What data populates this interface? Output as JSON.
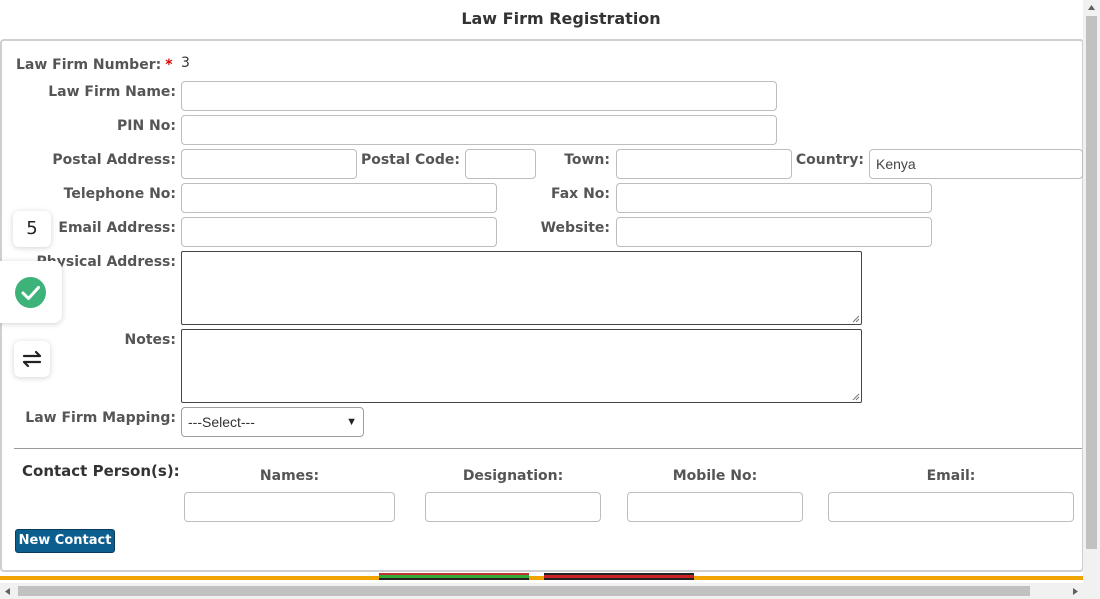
{
  "page": {
    "title": "Law Firm Registration"
  },
  "form": {
    "law_firm_number_label": "Law Firm Number:",
    "required_marker": "*",
    "law_firm_number_value": "3",
    "law_firm_name_label": "Law Firm Name:",
    "law_firm_name_value": "",
    "pin_label": "PIN No:",
    "pin_value": "",
    "postal_address_label": "Postal Address:",
    "postal_address_value": "",
    "postal_code_label": "Postal Code:",
    "postal_code_value": "",
    "town_label": "Town:",
    "town_value": "",
    "country_label": "Country:",
    "country_value": "Kenya",
    "telephone_label": "Telephone No:",
    "telephone_value": "",
    "fax_label": "Fax No:",
    "fax_value": "",
    "email_label": "Email Address:",
    "email_value": "",
    "website_label": "Website:",
    "website_value": "",
    "physical_address_label": "Physical Address:",
    "notes_label": "Notes:",
    "mapping_label": "Law Firm Mapping:",
    "mapping_selected": "---Select---"
  },
  "contacts": {
    "section_label": "Contact Person(s):",
    "columns": [
      "Names:",
      "Designation:",
      "Mobile No:",
      "Email:"
    ],
    "new_contact_button": "New Contact"
  },
  "widgets": {
    "badge_number": "5",
    "check_color": "#3db37a"
  },
  "colors": {
    "button": "#0c5e8f",
    "footer_bar": "#f0a400"
  }
}
